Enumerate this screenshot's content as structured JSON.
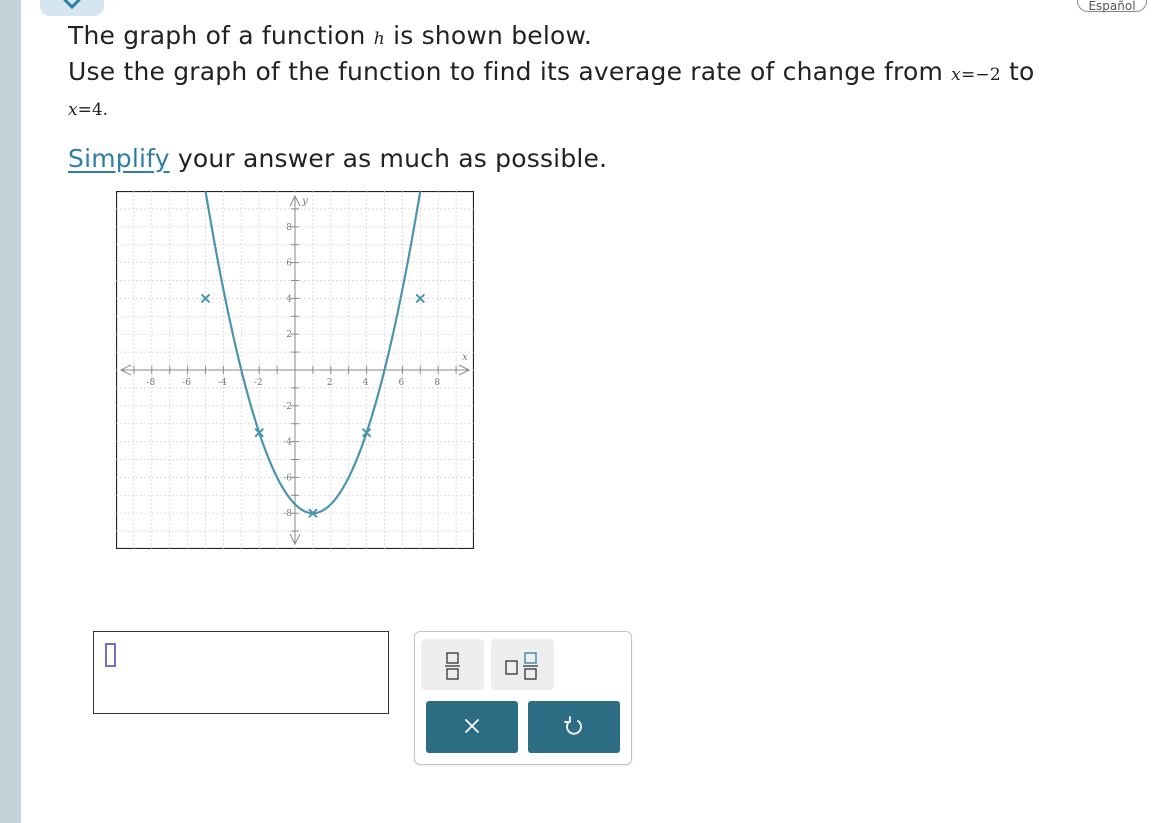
{
  "header": {
    "language_label": "Español"
  },
  "question": {
    "line1_prefix": "The graph of a function ",
    "function_name": "h",
    "line1_suffix": " is shown below.",
    "line2_text": "Use the graph of the function to find its average rate of change from ",
    "x_start_var": "x",
    "x_start_eq": "=",
    "x_start_val": "−2",
    "line2_to": " to",
    "x_end_var": "x",
    "x_end_eq": "=",
    "x_end_val": "4",
    "x_end_period": ".",
    "simplify_link": "Simplify",
    "simplify_rest": " your answer as much as possible."
  },
  "chart_data": {
    "type": "line",
    "title": "",
    "xlabel": "x",
    "ylabel": "y",
    "xlim": [
      -10,
      10
    ],
    "ylim": [
      -10,
      10
    ],
    "x_ticks": [
      -8,
      -6,
      -4,
      -2,
      2,
      4,
      6,
      8
    ],
    "y_ticks": [
      -8,
      -6,
      -4,
      -2,
      2,
      4,
      6,
      8
    ],
    "grid": true,
    "series": [
      {
        "function": "0.5*(x-1)^2 - 8",
        "x_range": [
          -6.4,
          8.6
        ],
        "color": "#4a95ad",
        "marked_points": [
          [
            -5,
            4
          ],
          [
            -2,
            -3.5
          ],
          [
            1,
            -8
          ],
          [
            4,
            -3.5
          ],
          [
            7,
            4
          ]
        ]
      }
    ]
  },
  "answer": {
    "value": ""
  },
  "keypad": {
    "fraction_button": "fraction",
    "mixed_number_button": "mixed number",
    "clear_button": "×",
    "undo_button": "undo"
  },
  "colors": {
    "curve": "#4a95ad",
    "link": "#2e7fa0",
    "button_dark": "#2d6d84",
    "button_light": "#eeeeee",
    "side_bar": "#c5d1d8"
  }
}
